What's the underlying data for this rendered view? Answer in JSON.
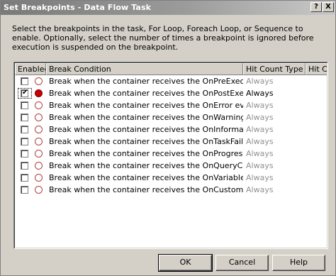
{
  "window": {
    "title": "Set Breakpoints - Data Flow Task",
    "help_glyph": "?",
    "close_glyph": "X"
  },
  "description": "Select the breakpoints in the task, For Loop, Foreach Loop, or Sequence to enable. Optionally, select the number of times a breakpoint is ignored before execution is suspended on the breakpoint.",
  "grid": {
    "columns": [
      "Enabled",
      "Break Condition",
      "Hit Count Type",
      "Hit Cou"
    ],
    "rows": [
      {
        "enabled": false,
        "condition": "Break when the container receives the OnPreExecute event",
        "hit_type": "Always"
      },
      {
        "enabled": true,
        "condition": "Break when the container receives the OnPostExecute event",
        "hit_type": "Always"
      },
      {
        "enabled": false,
        "condition": "Break when the container receives the OnError event",
        "hit_type": "Always"
      },
      {
        "enabled": false,
        "condition": "Break when the container receives the OnWarning event",
        "hit_type": "Always"
      },
      {
        "enabled": false,
        "condition": "Break when the container receives the OnInformation event",
        "hit_type": "Always"
      },
      {
        "enabled": false,
        "condition": "Break when the container receives the OnTaskFailed event",
        "hit_type": "Always"
      },
      {
        "enabled": false,
        "condition": "Break when the container receives the OnProgress event",
        "hit_type": "Always"
      },
      {
        "enabled": false,
        "condition": "Break when the container receives the OnQueryCancel event",
        "hit_type": "Always"
      },
      {
        "enabled": false,
        "condition": "Break when the container receives the OnVariableValueChang...",
        "hit_type": "Always"
      },
      {
        "enabled": false,
        "condition": "Break when the container receives the OnCustomEvent event",
        "hit_type": "Always"
      }
    ]
  },
  "buttons": {
    "ok": "OK",
    "cancel": "Cancel",
    "help": "Help"
  },
  "colors": {
    "breakpoint_active": "#cc0000",
    "disabled_text": "#909090"
  }
}
